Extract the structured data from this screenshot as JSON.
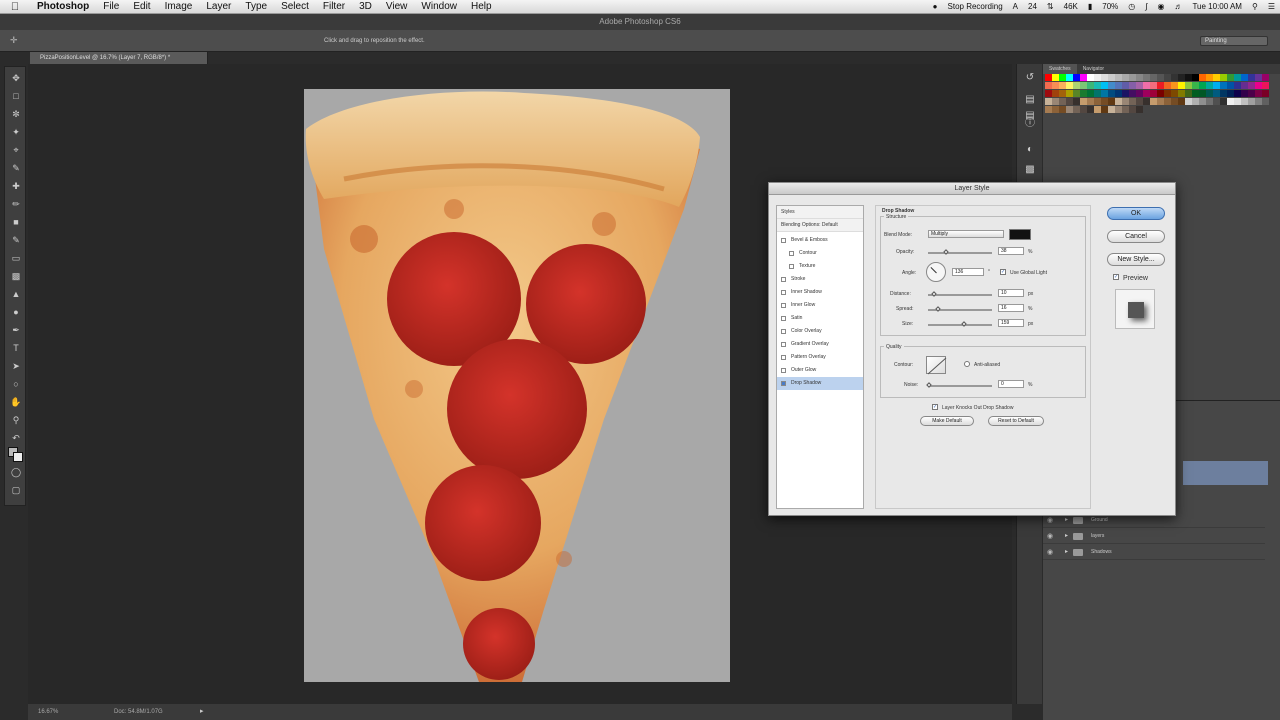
{
  "menubar": {
    "app": "Photoshop",
    "items": [
      "File",
      "Edit",
      "Image",
      "Layer",
      "Type",
      "Select",
      "Filter",
      "3D",
      "View",
      "Window",
      "Help"
    ],
    "status": {
      "recording": "Stop Recording",
      "adobe_count": "24",
      "network": "46K",
      "battery": "70%",
      "clock": "Tue 10:00 AM"
    }
  },
  "app_title": "Adobe Photoshop CS6",
  "options_bar": {
    "hint": "Click and drag to reposition the effect.",
    "workspace": "Painting"
  },
  "document_tab": "PizzaPositionLevel @ 16.7% (Layer 7, RGB/8*) *",
  "status_bar": {
    "zoom": "16.67%",
    "doc": "Doc: 54.8M/1.07G"
  },
  "right_panels": {
    "tabs": [
      "Swatches",
      "Navigator"
    ],
    "layers": [
      {
        "name": "Ground"
      },
      {
        "name": "layers"
      },
      {
        "name": "Shadows"
      }
    ]
  },
  "dialog": {
    "title": "Layer Style",
    "styles_list": [
      {
        "label": "Styles",
        "kind": "head",
        "checked": false
      },
      {
        "label": "Blending Options: Default",
        "kind": "head",
        "checked": false
      },
      {
        "label": "Bevel & Emboss",
        "kind": "item",
        "checked": false
      },
      {
        "label": "Contour",
        "kind": "sub",
        "checked": false
      },
      {
        "label": "Texture",
        "kind": "sub",
        "checked": false
      },
      {
        "label": "Stroke",
        "kind": "item",
        "checked": false
      },
      {
        "label": "Inner Shadow",
        "kind": "item",
        "checked": false
      },
      {
        "label": "Inner Glow",
        "kind": "item",
        "checked": false
      },
      {
        "label": "Satin",
        "kind": "item",
        "checked": false
      },
      {
        "label": "Color Overlay",
        "kind": "item",
        "checked": false
      },
      {
        "label": "Gradient Overlay",
        "kind": "item",
        "checked": false
      },
      {
        "label": "Pattern Overlay",
        "kind": "item",
        "checked": false
      },
      {
        "label": "Outer Glow",
        "kind": "item",
        "checked": false
      },
      {
        "label": "Drop Shadow",
        "kind": "item",
        "checked": true,
        "selected": true
      }
    ],
    "section_title": "Drop Shadow",
    "structure_title": "Structure",
    "blend_mode_label": "Blend Mode:",
    "blend_mode_value": "Multiply",
    "shadow_color": "#111111",
    "opacity_label": "Opacity:",
    "opacity_value": "38",
    "opacity_unit": "%",
    "angle_label": "Angle:",
    "angle_value": "136",
    "angle_unit": "°",
    "use_global_light_label": "Use Global Light",
    "use_global_light_checked": true,
    "distance_label": "Distance:",
    "distance_value": "10",
    "distance_unit": "px",
    "spread_label": "Spread:",
    "spread_value": "16",
    "spread_unit": "%",
    "size_label": "Size:",
    "size_value": "159",
    "size_unit": "px",
    "quality_title": "Quality",
    "contour_label": "Contour:",
    "anti_aliased_label": "Anti-aliased",
    "noise_label": "Noise:",
    "noise_value": "0",
    "noise_unit": "%",
    "knockout_label": "Layer Knocks Out Drop Shadow",
    "knockout_checked": true,
    "make_default": "Make Default",
    "reset_default": "Reset to Default",
    "ok": "OK",
    "cancel": "Cancel",
    "new_style": "New Style...",
    "preview_label": "Preview",
    "preview_checked": true
  }
}
